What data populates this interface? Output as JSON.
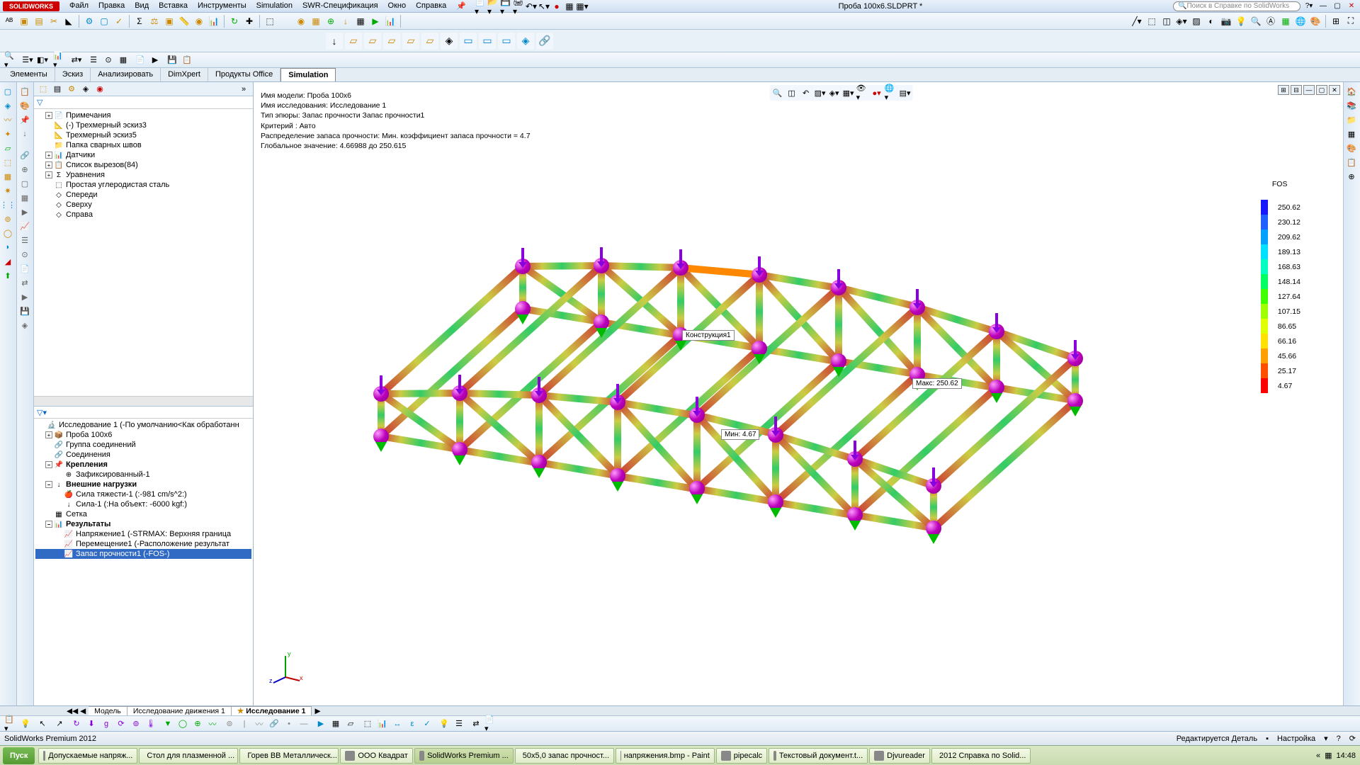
{
  "titlebar": {
    "logo": "SOLIDWORKS",
    "document": "Проба 100х6.SLDPRT *",
    "search_placeholder": "Поиск в Справке по SolidWorks"
  },
  "menu": [
    "Файл",
    "Правка",
    "Вид",
    "Вставка",
    "Инструменты",
    "Simulation",
    "SWR-Спецификация",
    "Окно",
    "Справка"
  ],
  "cmdtabs": [
    "Элементы",
    "Эскиз",
    "Анализировать",
    "DimXpert",
    "Продукты Office",
    "Simulation"
  ],
  "cmdtab_active": 5,
  "feature_tree_top": [
    {
      "indent": 1,
      "exp": "+",
      "icon": "📄",
      "label": "Примечания"
    },
    {
      "indent": 1,
      "exp": "",
      "icon": "📐",
      "label": "(-) Трехмерный эскиз3"
    },
    {
      "indent": 1,
      "exp": "",
      "icon": "📐",
      "label": "Трехмерный эскиз5"
    },
    {
      "indent": 1,
      "exp": "",
      "icon": "📁",
      "label": "Папка сварных швов"
    },
    {
      "indent": 1,
      "exp": "+",
      "icon": "📊",
      "label": "Датчики"
    },
    {
      "indent": 1,
      "exp": "+",
      "icon": "📋",
      "label": "Список вырезов(84)"
    },
    {
      "indent": 1,
      "exp": "+",
      "icon": "Σ",
      "label": "Уравнения"
    },
    {
      "indent": 1,
      "exp": "",
      "icon": "⬚",
      "label": "Простая углеродистая сталь"
    },
    {
      "indent": 1,
      "exp": "",
      "icon": "◇",
      "label": "Спереди"
    },
    {
      "indent": 1,
      "exp": "",
      "icon": "◇",
      "label": "Сверху"
    },
    {
      "indent": 1,
      "exp": "",
      "icon": "◇",
      "label": "Справа"
    }
  ],
  "sim_tree": [
    {
      "indent": 0,
      "exp": "",
      "icon": "🔬",
      "label": "Исследование 1 (-По умолчанию<Как обработанн"
    },
    {
      "indent": 1,
      "exp": "+",
      "icon": "📦",
      "label": "Проба 100х6"
    },
    {
      "indent": 1,
      "exp": "",
      "icon": "🔗",
      "label": "Группа соединений"
    },
    {
      "indent": 1,
      "exp": "",
      "icon": "🔗",
      "label": "Соединения"
    },
    {
      "indent": 1,
      "exp": "−",
      "icon": "📌",
      "label": "Крепления",
      "bold": true
    },
    {
      "indent": 2,
      "exp": "",
      "icon": "⊕",
      "label": "Зафиксированный-1"
    },
    {
      "indent": 1,
      "exp": "−",
      "icon": "↓",
      "label": "Внешние нагрузки",
      "bold": true
    },
    {
      "indent": 2,
      "exp": "",
      "icon": "🍎",
      "label": "Сила тяжести-1 (:-981 cm/s^2:)"
    },
    {
      "indent": 2,
      "exp": "",
      "icon": "↓",
      "label": "Сила-1 (:На объект: -6000 kgf:)"
    },
    {
      "indent": 1,
      "exp": "",
      "icon": "▦",
      "label": "Сетка"
    },
    {
      "indent": 1,
      "exp": "−",
      "icon": "📊",
      "label": "Результаты",
      "bold": true
    },
    {
      "indent": 2,
      "exp": "",
      "icon": "📈",
      "label": "Напряжение1 (-STRMAX: Верхняя граница"
    },
    {
      "indent": 2,
      "exp": "",
      "icon": "📈",
      "label": "Перемещение1 (-Расположение результат"
    },
    {
      "indent": 2,
      "exp": "",
      "icon": "📈",
      "label": "Запас прочности1 (-FOS-)",
      "sel": true
    }
  ],
  "study_info": [
    "Имя модели: Проба 100х6",
    "Имя исследования: Исследование 1",
    "Тип эпюры: Запас прочности Запас прочности1",
    "Критерий : Авто",
    "Распределение запаса прочности: Мин. коэффициент запаса прочности = 4.7",
    "Глобальное значение: 4.66988 до 250.615"
  ],
  "legend": {
    "title": "FOS",
    "values": [
      "250.62",
      "230.12",
      "209.62",
      "189.13",
      "168.63",
      "148.14",
      "127.64",
      "107.15",
      "86.65",
      "66.16",
      "45.66",
      "25.17",
      "4.67"
    ],
    "colors": [
      "#1818ff",
      "#2060ff",
      "#00a0ff",
      "#00e0ff",
      "#00ffc0",
      "#00ff60",
      "#40ff00",
      "#a0ff00",
      "#e0ff00",
      "#ffe000",
      "#ffa000",
      "#ff5000",
      "#ff0000"
    ]
  },
  "annotations": {
    "tooltip": "Конструкция1",
    "max": "Макс: 250.62",
    "min": "Мин: 4.67"
  },
  "bottom_tabs": [
    "Модель",
    "Исследование движения 1",
    "Исследование 1"
  ],
  "bottom_tab_active": 2,
  "status": {
    "left": "SolidWorks Premium 2012",
    "editing": "Редактируется Деталь",
    "custom": "Настройка"
  },
  "taskbar": {
    "start": "Пуск",
    "items": [
      "Допускаемые напряж...",
      "Стол для плазменной ...",
      "Горев ВВ Металлическ...",
      "ООО Квадрат",
      "SolidWorks Premium ...",
      "50х5,0 запас прочност...",
      "напряжения.bmp - Paint",
      "pipecalc",
      "Текстовый документ.t...",
      "Djvureader",
      "2012 Справка по Solid..."
    ],
    "active_index": 4,
    "time": "14:48"
  }
}
